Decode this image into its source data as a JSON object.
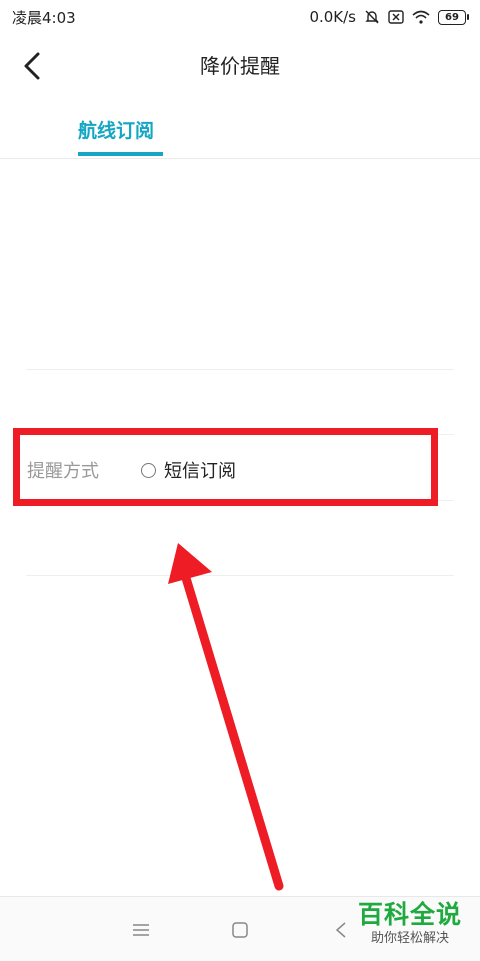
{
  "status": {
    "time": "凌晨4:03",
    "speed": "0.0K/s",
    "battery": "69"
  },
  "header": {
    "title": "降价提醒"
  },
  "tabs": [
    {
      "label": "航线订阅",
      "active": true
    }
  ],
  "form": {
    "notify_label": "提醒方式",
    "option_label": "短信订阅",
    "option_checked": false
  },
  "accent_color": "#14a6c4",
  "annotation_color": "#ee1c24",
  "icons": [
    "back-arrow",
    "mute-bell",
    "sim-x",
    "wifi",
    "battery",
    "menu",
    "home-square",
    "back-triangle"
  ],
  "watermark": {
    "main": "百科全说",
    "sub": "助你轻松解决"
  }
}
